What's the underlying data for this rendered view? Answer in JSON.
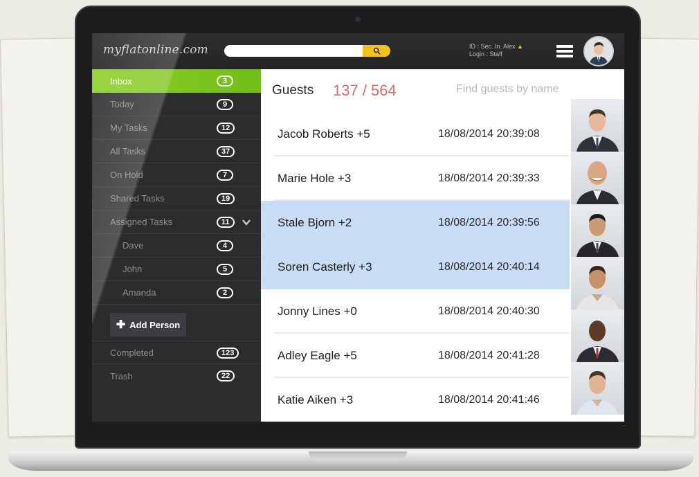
{
  "header": {
    "logo": "myflatonline.com",
    "search": {
      "placeholder": ""
    },
    "id_line": "ID  : Sec. In. Alex",
    "login_line": "Login : Staff"
  },
  "sidebar": {
    "items": [
      {
        "label": "Inbox",
        "count": "3"
      },
      {
        "label": "Today",
        "count": "9"
      },
      {
        "label": "My Tasks",
        "count": "12"
      },
      {
        "label": "All Tasks",
        "count": "37"
      },
      {
        "label": "On Hold",
        "count": "7"
      },
      {
        "label": "Shared Tasks",
        "count": "19"
      },
      {
        "label": "Assigned Tasks",
        "count": "11"
      },
      {
        "label": "Dave",
        "count": "4"
      },
      {
        "label": "John",
        "count": "5"
      },
      {
        "label": "Amanda",
        "count": "2"
      },
      {
        "label": "Completed",
        "count": "123"
      },
      {
        "label": "Trash",
        "count": "22"
      }
    ],
    "add_person": "Add Person"
  },
  "main": {
    "title": "Guests",
    "count": "137 / 564",
    "find_placeholder": "Find guests by name",
    "guests": [
      {
        "name": "Jacob Roberts +5",
        "time": "18/08/2014 20:39:08"
      },
      {
        "name": "Marie Hole +3",
        "time": "18/08/2014 20:39:33"
      },
      {
        "name": "Stale Bjorn +2",
        "time": "18/08/2014 20:39:56"
      },
      {
        "name": "Soren Casterly +3",
        "time": "18/08/2014 20:40:14"
      },
      {
        "name": "Jonny Lines +0",
        "time": "18/08/2014 20:40:30"
      },
      {
        "name": "Adley Eagle +5",
        "time": "18/08/2014 20:41:28"
      },
      {
        "name": "Katie Aiken +3",
        "time": "18/08/2014 20:41:46"
      }
    ]
  },
  "colors": {
    "accent_green": "#7cc520",
    "count_red": "#e06b6b",
    "selected_row": "#c9dcf6",
    "search_button": "#f2c21a"
  }
}
